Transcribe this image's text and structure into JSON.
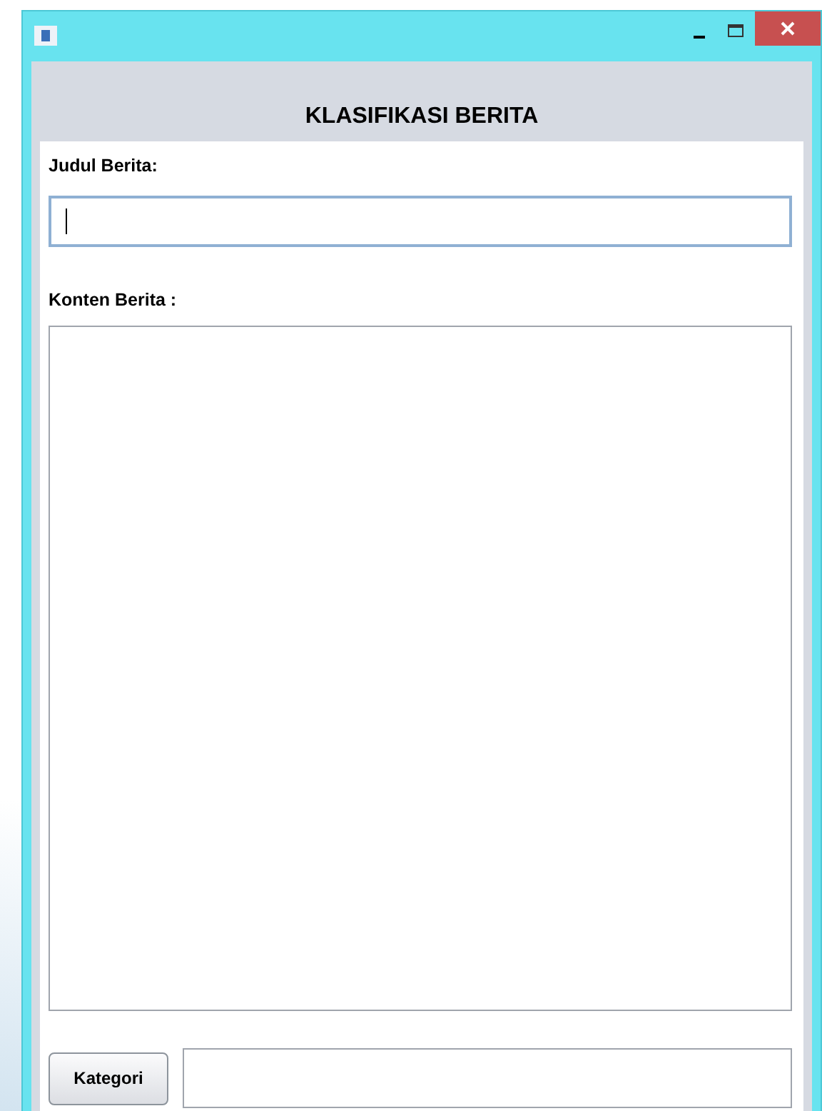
{
  "header": {
    "title": "KLASIFIKASI BERITA"
  },
  "form": {
    "title_label": "Judul Berita:",
    "title_field": {
      "focused": true
    },
    "content_label": "Konten Berita :",
    "category_button": "Kategori"
  }
}
